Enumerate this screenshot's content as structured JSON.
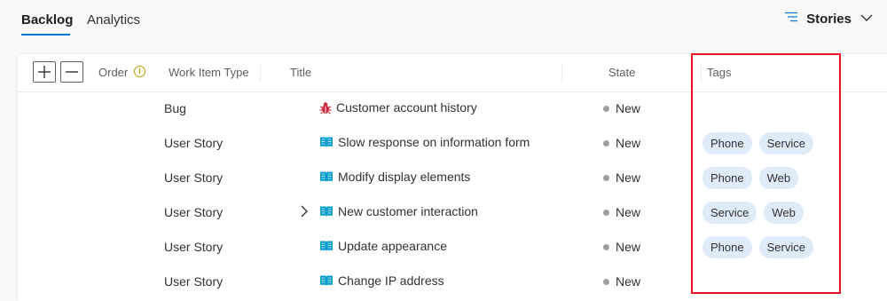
{
  "tabs": {
    "backlog": "Backlog",
    "analytics": "Analytics"
  },
  "view_selector": {
    "label": "Stories"
  },
  "columns": {
    "order": "Order",
    "work_item_type": "Work Item Type",
    "title": "Title",
    "state": "State",
    "tags": "Tags"
  },
  "rows": [
    {
      "type": "Bug",
      "icon": "bug-icon",
      "title": "Customer account history",
      "state": "New",
      "tags": []
    },
    {
      "type": "User Story",
      "icon": "book-icon",
      "title": "Slow response on information form",
      "state": "New",
      "tags": [
        "Phone",
        "Service"
      ]
    },
    {
      "type": "User Story",
      "icon": "book-icon",
      "title": "Modify display elements",
      "state": "New",
      "tags": [
        "Phone",
        "Web"
      ]
    },
    {
      "type": "User Story",
      "icon": "book-icon",
      "title": "New customer interaction",
      "state": "New",
      "tags": [
        "Service",
        "Web"
      ],
      "expandable": true
    },
    {
      "type": "User Story",
      "icon": "book-icon",
      "title": "Update appearance",
      "state": "New",
      "tags": [
        "Phone",
        "Service"
      ]
    },
    {
      "type": "User Story",
      "icon": "book-icon",
      "title": "Change IP address",
      "state": "New",
      "tags": []
    }
  ],
  "colors": {
    "accent": "#0078d4",
    "tag_bg": "#deecf9",
    "bug": "#cc293d",
    "story": "#009ccc",
    "highlight": "#e81123"
  }
}
